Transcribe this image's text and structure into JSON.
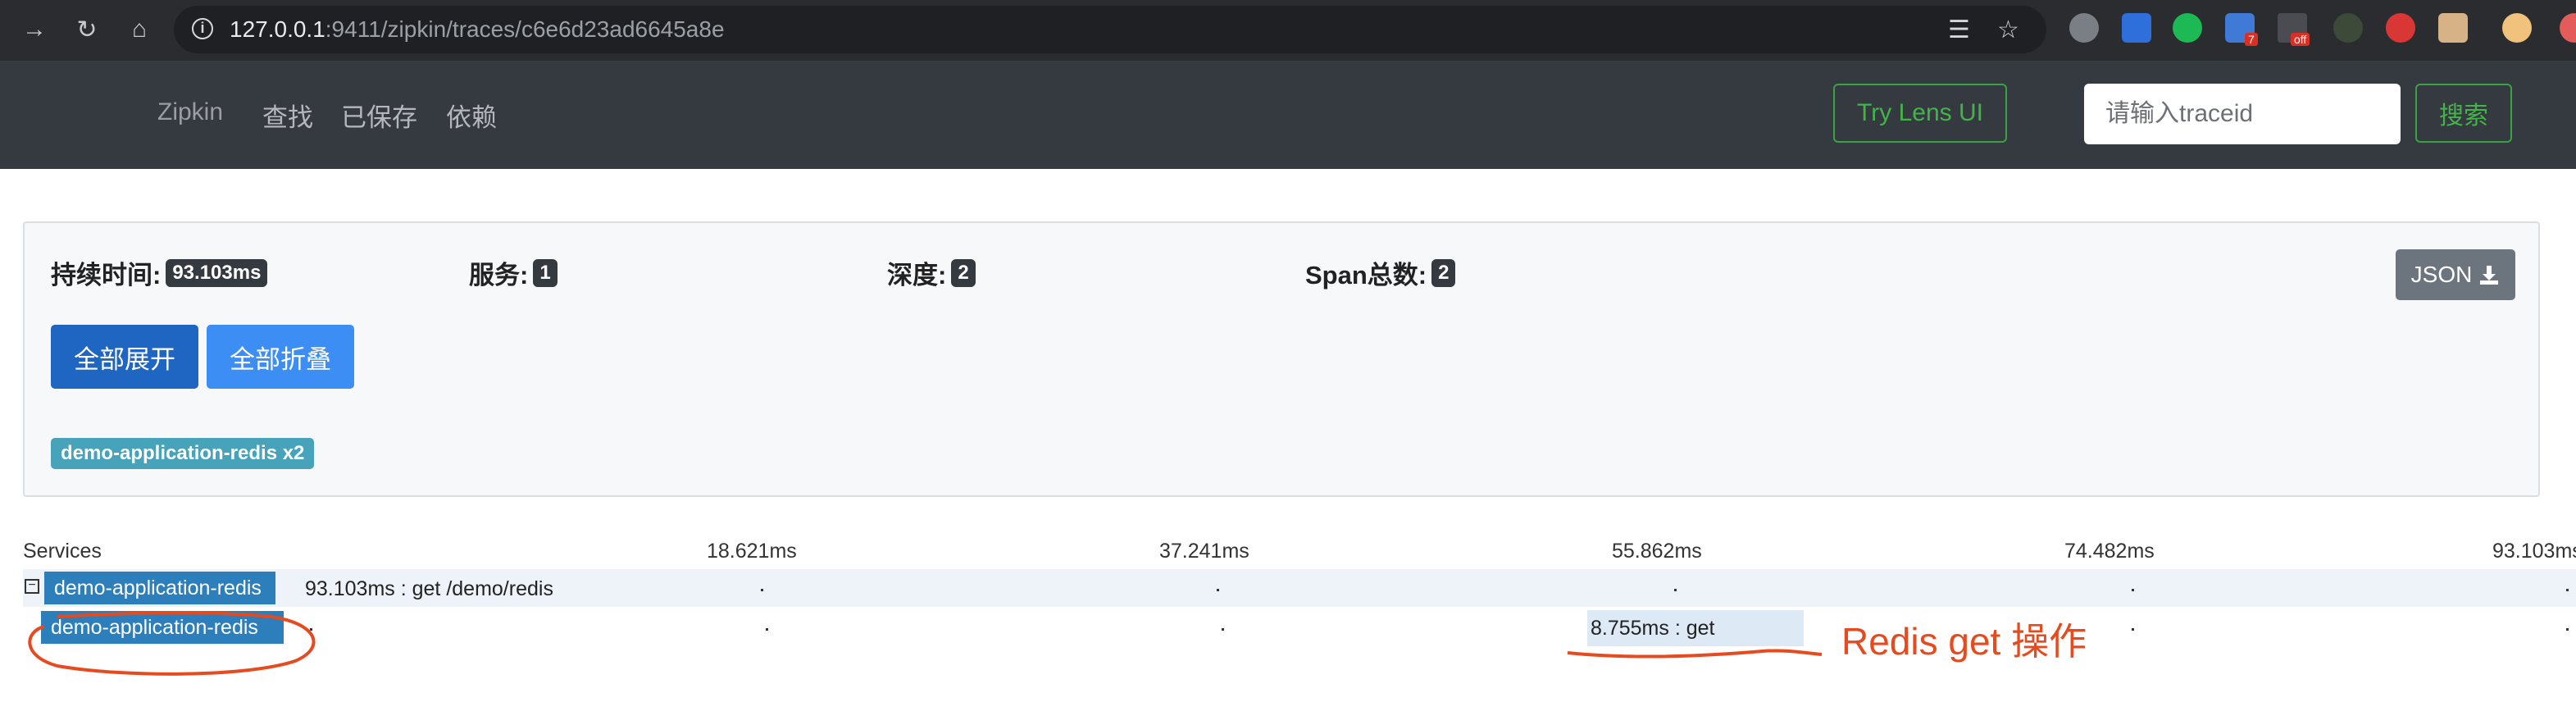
{
  "browser": {
    "url_host": "127.0.0.1",
    "url_rest": ":9411/zipkin/traces/c6e6d23ad6645a8e",
    "ext_badge_1": "7",
    "ext_badge_2": "off"
  },
  "nav": {
    "brand": "Zipkin",
    "links": [
      "查找",
      "已保存",
      "依赖"
    ],
    "try_lens": "Try Lens UI",
    "traceid_placeholder": "请输入traceid",
    "search": "搜索"
  },
  "summary": {
    "duration_label": "持续时间:",
    "duration_value": "93.103ms",
    "services_label": "服务:",
    "services_value": "1",
    "depth_label": "深度:",
    "depth_value": "2",
    "span_total_label": "Span总数:",
    "span_total_value": "2",
    "json_button": "JSON",
    "expand_all": "全部展开",
    "collapse_all": "全部折叠",
    "service_tag": "demo-application-redis x2"
  },
  "timeline": {
    "services_header": "Services",
    "ticks": [
      "18.621ms",
      "37.241ms",
      "55.862ms",
      "74.482ms",
      "93.103ms"
    ],
    "rows": [
      {
        "service": "demo-application-redis",
        "span": "93.103ms : get /demo/redis",
        "toggle": "−"
      },
      {
        "service": "demo-application-redis",
        "span": "8.755ms : get"
      }
    ]
  },
  "annotation": "Redis get 操作",
  "colors": {
    "header_bg": "#343a40",
    "accent_green": "#44b34a",
    "service_blue": "#2c7fbb",
    "annotation_red": "#e64a1f"
  }
}
